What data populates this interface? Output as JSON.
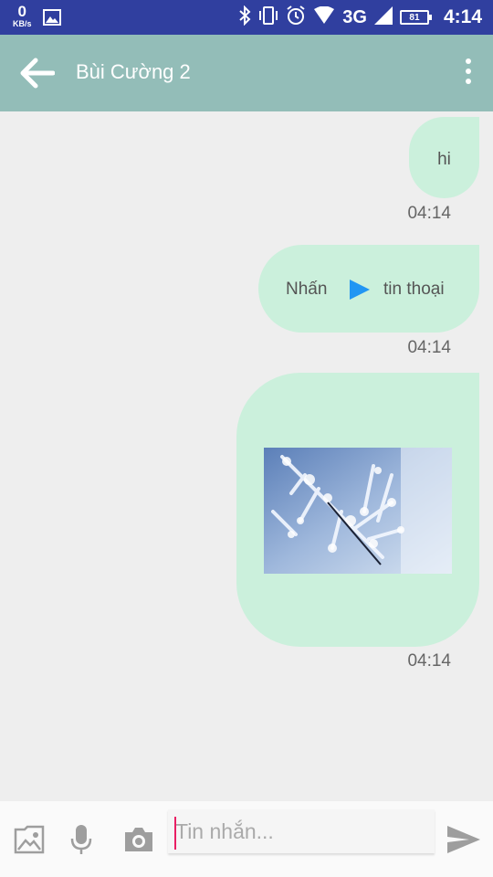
{
  "status_bar": {
    "net_speed_value": "0",
    "net_speed_unit": "KB/s",
    "network_type": "3G",
    "battery_level": "81",
    "clock": "4:14"
  },
  "header": {
    "contact_name": "Bùi Cường 2"
  },
  "messages": [
    {
      "type": "text",
      "text": "hi",
      "time": "04:14"
    },
    {
      "type": "voice",
      "text_before": "Nhấn",
      "text_after": "tin thoại",
      "time": "04:14"
    },
    {
      "type": "image",
      "time": "04:14"
    }
  ],
  "composer": {
    "placeholder": "Tin nhắn..."
  },
  "icons": {
    "back": "arrow-left-icon",
    "more": "more-vert-icon",
    "gallery": "image-gallery-icon",
    "mic": "microphone-icon",
    "camera": "camera-icon",
    "send": "send-icon",
    "play": "play-icon"
  },
  "colors": {
    "status_bar": "#303f9f",
    "app_bar": "#93bdb8",
    "bubble": "#cbf0dc",
    "background": "#eeeeee",
    "play_button": "#2196f3",
    "caret": "#e91e63"
  }
}
